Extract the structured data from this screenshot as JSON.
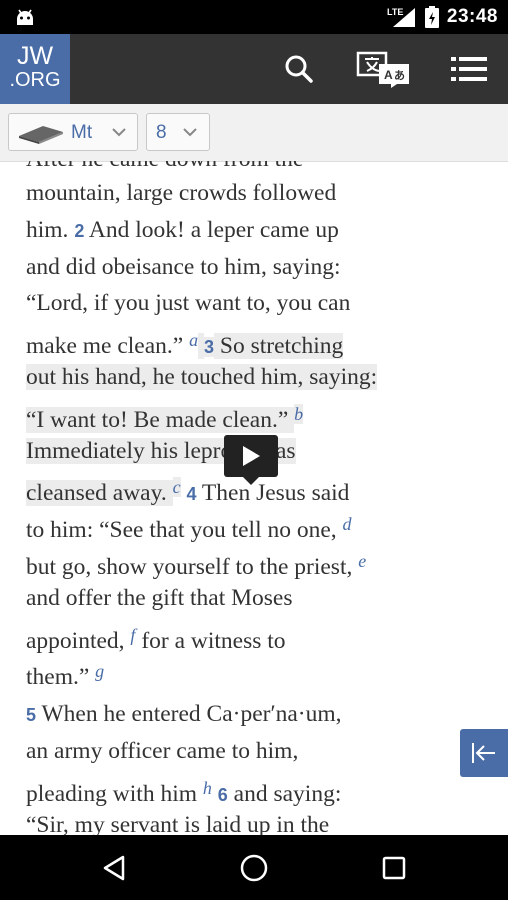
{
  "status": {
    "time": "23:48",
    "network": "LTE"
  },
  "logo": {
    "line1": "JW",
    "line2": ".ORG"
  },
  "nav": {
    "book": "Mt",
    "chapter": "8"
  },
  "content": {
    "cutoff_line": "After he came down from the",
    "lines": [
      [
        {
          "t": "text",
          "v": "mountain, large crowds followed"
        }
      ],
      [
        {
          "t": "text",
          "v": "him. "
        },
        {
          "t": "vn",
          "v": "2"
        },
        {
          "t": "text",
          "v": "  And look! a leper came up"
        }
      ],
      [
        {
          "t": "text",
          "v": "and did obeisance to him, saying:"
        }
      ],
      [
        {
          "t": "text",
          "v": "“Lord, if you just want to, you can"
        }
      ],
      [
        {
          "t": "text",
          "v": "make me clean.” "
        },
        {
          "t": "fn",
          "v": "a"
        },
        {
          "t": "hl",
          "v": " "
        },
        {
          "t": "vnhl",
          "v": "3"
        },
        {
          "t": "hl",
          "v": "  So stretching"
        }
      ],
      [
        {
          "t": "hl",
          "v": "out his hand, he touched him, saying:"
        }
      ],
      [
        {
          "t": "hl",
          "v": "“I want to! Be made clean.” "
        },
        {
          "t": "fnhl",
          "v": "b"
        }
      ],
      [
        {
          "t": "hl",
          "v": "Immediately his leprosy was"
        }
      ],
      [
        {
          "t": "hl",
          "v": "cleansed away. "
        },
        {
          "t": "fnhl",
          "v": "c"
        },
        {
          "t": "text",
          "v": "  "
        },
        {
          "t": "vn",
          "v": "4"
        },
        {
          "t": "text",
          "v": "  Then Jesus said"
        }
      ],
      [
        {
          "t": "text",
          "v": "to him: “See that you tell no one, "
        },
        {
          "t": "fn",
          "v": "d"
        }
      ],
      [
        {
          "t": "text",
          "v": "but go, show yourself to the priest, "
        },
        {
          "t": "fn",
          "v": "e"
        }
      ],
      [
        {
          "t": "text",
          "v": "and offer the gift that Moses"
        }
      ],
      [
        {
          "t": "text",
          "v": "appointed, "
        },
        {
          "t": "fn",
          "v": "f"
        },
        {
          "t": "text",
          "v": "  for a witness to"
        }
      ],
      [
        {
          "t": "text",
          "v": "them.” "
        },
        {
          "t": "fn",
          "v": "g"
        }
      ],
      [
        {
          "t": "text",
          "v": "    "
        },
        {
          "t": "vn",
          "v": "5"
        },
        {
          "t": "text",
          "v": "  When he entered Ca·per′na·um,"
        }
      ],
      [
        {
          "t": "text",
          "v": "an army officer came to him,"
        }
      ],
      [
        {
          "t": "text",
          "v": "pleading with him "
        },
        {
          "t": "fn",
          "v": "h"
        },
        {
          "t": "text",
          "v": " "
        },
        {
          "t": "vn",
          "v": "6"
        },
        {
          "t": "text",
          "v": "  and saying:"
        }
      ],
      [
        {
          "t": "text",
          "v": "“Sir, my servant is laid up in the"
        }
      ]
    ]
  },
  "icons": {
    "search": "search-icon",
    "translate": "translate-icon",
    "menu": "menu-icon",
    "book": "book-icon",
    "play": "play-icon",
    "collapse": "collapse-sidebar-icon",
    "back": "back-icon",
    "home": "home-icon",
    "recents": "recents-icon"
  },
  "colors": {
    "accent": "#4a6da7",
    "toolbar": "#333333",
    "highlight": "#ececec",
    "text": "#333333"
  }
}
